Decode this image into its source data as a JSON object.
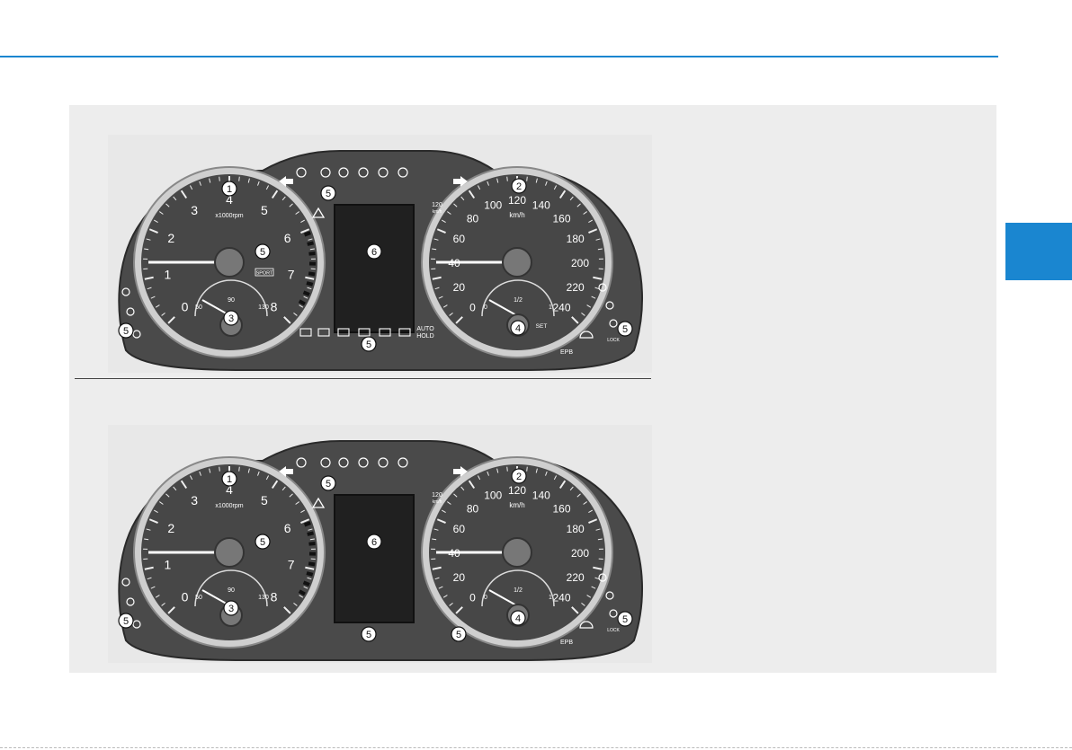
{
  "colors": {
    "accent": "#1a86d0",
    "panel": "#ededed",
    "cluster": "#4a4a4a"
  },
  "tach_numbers": [
    "0",
    "1",
    "2",
    "3",
    "4",
    "5",
    "6",
    "7",
    "8"
  ],
  "tach_unit": "x1000rpm",
  "speed_numbers": [
    "0",
    "20",
    "40",
    "60",
    "80",
    "100",
    "120",
    "140",
    "160",
    "180",
    "200",
    "220",
    "240"
  ],
  "speed_unit": "km/h",
  "temp_gauge": {
    "low": "50",
    "mid": "90",
    "high": "130"
  },
  "fuel_gauge": {
    "empty": "0",
    "half": "1/2",
    "full": "1"
  },
  "callouts": {
    "c1": "1",
    "c2": "2",
    "c3": "3",
    "c4": "4",
    "c5": "5",
    "c6": "6"
  },
  "labels": {
    "sport": "SPORT",
    "set": "SET",
    "epb": "EPB",
    "auto": "AUTO",
    "hold": "HOLD",
    "speed_limit": "120",
    "speed_limit_unit": "km/h",
    "lock": "LOCK"
  },
  "icons": [
    "turn-left-arrow-icon",
    "turn-right-arrow-icon",
    "hazard-triangle-icon",
    "headlight-icon",
    "fog-light-icon",
    "tpms-icon",
    "seatbelt-icon",
    "airbag-icon",
    "battery-icon",
    "oil-pressure-icon",
    "fuel-icon",
    "engine-check-icon",
    "brake-icon"
  ]
}
